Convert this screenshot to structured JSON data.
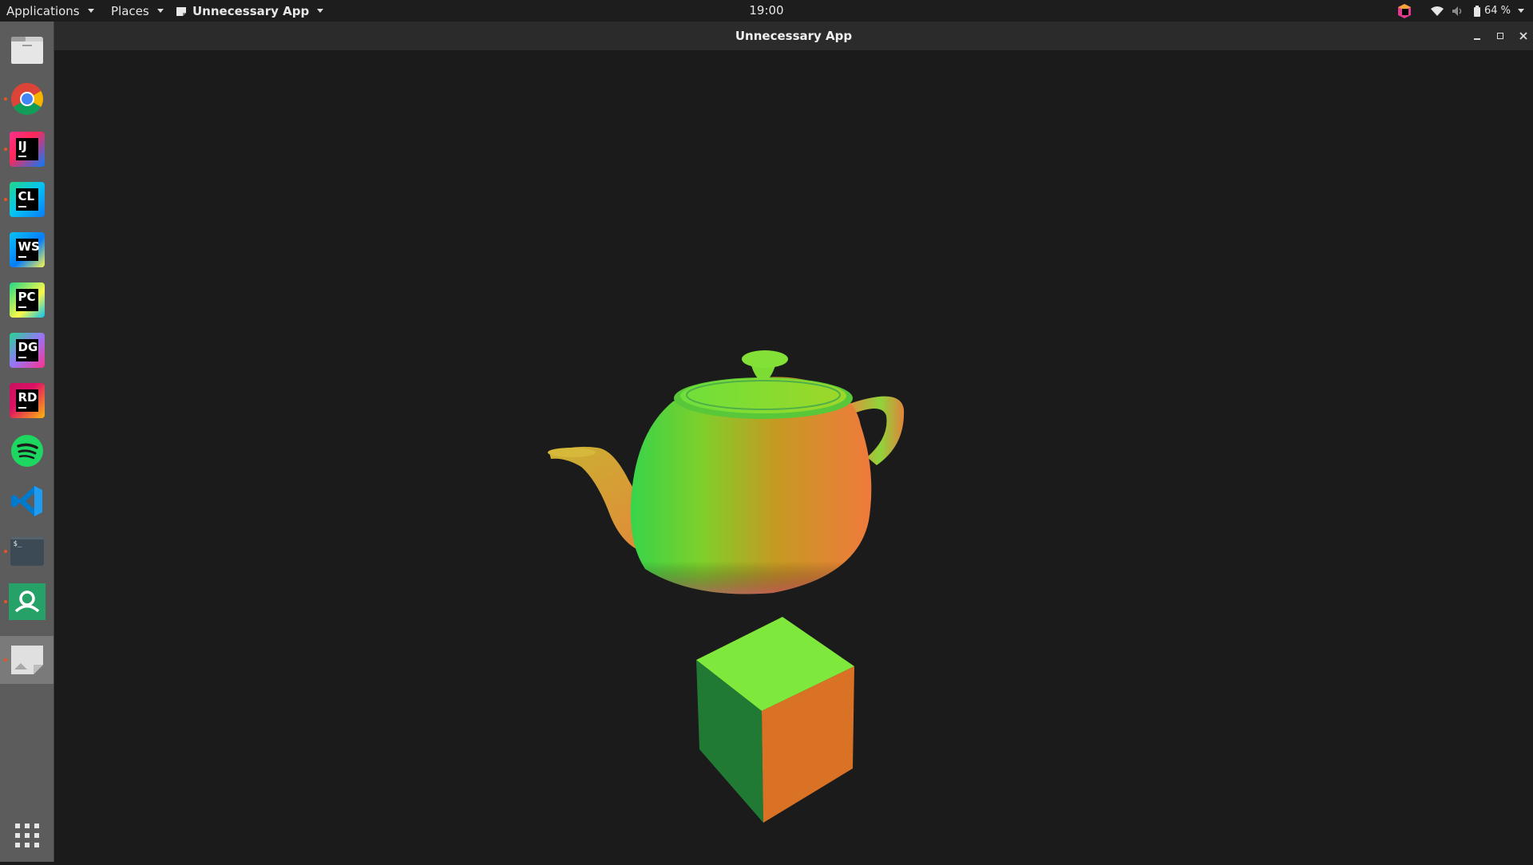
{
  "top_panel": {
    "applications_label": "Applications",
    "places_label": "Places",
    "app_menu_label": "Unnecessary App",
    "clock": "19:00",
    "battery_percent": "64 %"
  },
  "window": {
    "title": "Unnecessary App"
  },
  "dock": {
    "items": [
      {
        "name": "Files",
        "icon": "files-icon"
      },
      {
        "name": "Chrome",
        "icon": "chrome-icon"
      },
      {
        "name": "IntelliJ IDEA",
        "icon": "intellij-icon",
        "text": "IJ"
      },
      {
        "name": "CLion",
        "icon": "clion-icon",
        "text": "CL"
      },
      {
        "name": "WebStorm",
        "icon": "webstorm-icon",
        "text": "WS"
      },
      {
        "name": "PyCharm",
        "icon": "pycharm-icon",
        "text": "PC"
      },
      {
        "name": "DataGrip",
        "icon": "datagrip-icon",
        "text": "DG"
      },
      {
        "name": "Rider",
        "icon": "rider-icon",
        "text": "RD"
      },
      {
        "name": "Spotify",
        "icon": "spotify-icon"
      },
      {
        "name": "VS Code",
        "icon": "vscode-icon"
      },
      {
        "name": "Terminal",
        "icon": "terminal-icon",
        "text": "$_"
      },
      {
        "name": "Remote Viewer",
        "icon": "remote-icon"
      },
      {
        "name": "Unnecessary App",
        "icon": "app-window-icon"
      }
    ],
    "show_apps_icon": "grid-icon"
  },
  "scene": {
    "objects": [
      "teapot",
      "cube"
    ],
    "colors": {
      "background": "#1b1b1b",
      "cube_top": "#7ee83c",
      "cube_left": "#217a33",
      "cube_right": "#da7225",
      "teapot_green": "#5fd83a",
      "teapot_orange": "#e07a36"
    }
  }
}
